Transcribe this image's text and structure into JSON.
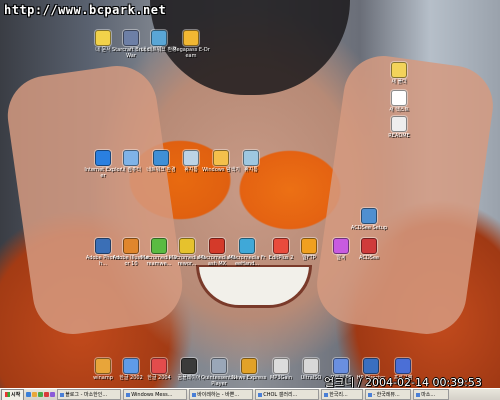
{
  "watermark": "http://www.bcpark.net",
  "timestamp": "얼크니 / 2004-02-14 00:39:53",
  "desktop_icons": [
    {
      "label": "내 문서",
      "icon": "my-documents-icon",
      "color": "#f2d24a"
    },
    {
      "label": "Starcraft Brood War",
      "icon": "starcraft-icon",
      "color": "#6d7fa6"
    },
    {
      "label": "내 네트워크 환경",
      "icon": "network-icon",
      "color": "#5aa6d6"
    },
    {
      "label": "Megapass E-Dream",
      "icon": "megapass-icon",
      "color": "#f1b733"
    },
    {
      "label": "새 폴더",
      "icon": "folder-icon",
      "color": "#f3d35a"
    },
    {
      "label": "새 텍스트",
      "icon": "text-file-icon",
      "color": "#ffffff"
    },
    {
      "label": "README",
      "icon": "readme-icon",
      "color": "#eeeeee"
    },
    {
      "label": "Internet Explorer",
      "icon": "internet-explorer-icon",
      "color": "#2a7fe0"
    },
    {
      "label": "내 컴퓨터",
      "icon": "my-computer-icon",
      "color": "#7fb3e8"
    },
    {
      "label": "네트워크 환경",
      "icon": "network-places-icon",
      "color": "#3f8fd6"
    },
    {
      "label": "휴지통",
      "icon": "recycle-bin-icon",
      "color": "#bcd3e6"
    },
    {
      "label": "Windows 탐색기",
      "icon": "explorer-icon",
      "color": "#f4c04b"
    },
    {
      "label": "휴지통",
      "icon": "trash-icon",
      "color": "#9ec7e0"
    },
    {
      "label": "Adobe Photosh...",
      "icon": "photoshop-icon",
      "color": "#3b6fb6"
    },
    {
      "label": "Adobe Illustrator 10",
      "icon": "illustrator-icon",
      "color": "#e0862c"
    },
    {
      "label": "Macromedia Dreamwe...",
      "icon": "dreamweaver-icon",
      "color": "#5abb42"
    },
    {
      "label": "Macromedia Firewor...",
      "icon": "fireworks-icon",
      "color": "#e6c22d"
    },
    {
      "label": "Macromedia Flash MX",
      "icon": "flash-icon",
      "color": "#d43a2a"
    },
    {
      "label": "Macromedia FreeHand...",
      "icon": "freehand-icon",
      "color": "#3fa8d8"
    },
    {
      "label": "EditPlus 2",
      "icon": "editplus-icon",
      "color": "#e94b3c"
    },
    {
      "label": "알FTP",
      "icon": "alftp-icon",
      "color": "#f0a020"
    },
    {
      "label": "알씨",
      "icon": "alsee-icon",
      "color": "#c85be0"
    },
    {
      "label": "ACDSee",
      "icon": "acdsee-icon",
      "color": "#cf3b3b"
    },
    {
      "label": "ACDSee Setup",
      "icon": "acdsee-setup-icon",
      "color": "#4f8fd0"
    },
    {
      "label": "winamp",
      "icon": "winamp-icon",
      "color": "#e8a53a"
    },
    {
      "label": "한글 2002",
      "icon": "hangul-icon",
      "color": "#5f9be8"
    },
    {
      "label": "한글 2004",
      "icon": "hangul-2004-icon",
      "color": "#e24c4c"
    },
    {
      "label": "곰플레이어",
      "icon": "gom-player-icon",
      "color": "#3b3b3b"
    },
    {
      "label": "Quintessential Player",
      "icon": "qcd-player-icon",
      "color": "#9aa7b8"
    },
    {
      "label": "News Express",
      "icon": "news-express-icon",
      "color": "#e2a228"
    },
    {
      "label": "MP3Gain",
      "icon": "mp3gain-icon",
      "color": "#dcdcdc"
    },
    {
      "label": "UltraISO",
      "icon": "ultraiso-icon",
      "color": "#d8d8d8"
    },
    {
      "label": "포토샵 PS",
      "icon": "photo-ps-icon",
      "color": "#6a8fe0"
    },
    {
      "label": "HP Director",
      "icon": "hp-director-icon",
      "color": "#3a6fc0"
    },
    {
      "label": "프로그램",
      "icon": "programs-icon",
      "color": "#4b6fd6"
    }
  ],
  "taskbar": {
    "start_label": "시작",
    "quick_launch_colors": [
      "#3a7fd8",
      "#e8a83a",
      "#4aa84a",
      "#d83a3a",
      "#8a5ad8"
    ],
    "tasks": [
      "블로그 - 마소한인...",
      "Windows Mess...",
      "바이레하는 - 바쁜...",
      "CHOL 갤러리...",
      "한국리...",
      "- 한국레뷰...",
      "마소..."
    ]
  }
}
